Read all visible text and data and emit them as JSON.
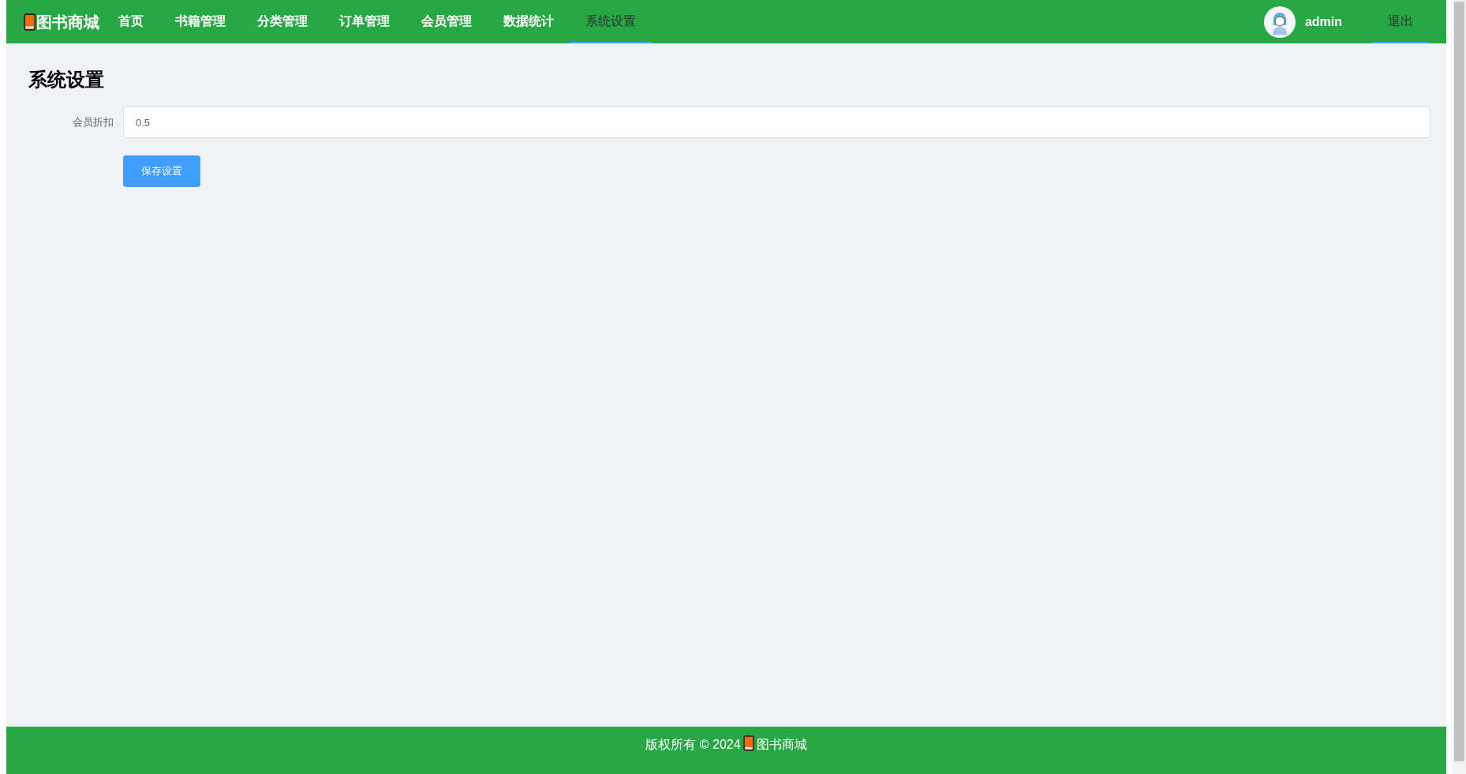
{
  "header": {
    "logo": "图书商城",
    "nav": [
      {
        "label": "首页",
        "selected": false
      },
      {
        "label": "书籍管理",
        "selected": false
      },
      {
        "label": "分类管理",
        "selected": false
      },
      {
        "label": "订单管理",
        "selected": false
      },
      {
        "label": "会员管理",
        "selected": false
      },
      {
        "label": "数据统计",
        "selected": false
      },
      {
        "label": "系统设置",
        "selected": true
      }
    ],
    "user": "admin",
    "logout": {
      "label": "退出",
      "selected": true
    }
  },
  "page": {
    "title": "系统设置",
    "fields": [
      {
        "label": "会员折扣",
        "value": "0.5"
      }
    ],
    "save_button": "保存设置"
  },
  "footer": {
    "copyright": "版权所有 © 2024",
    "brand": "图书商城"
  }
}
